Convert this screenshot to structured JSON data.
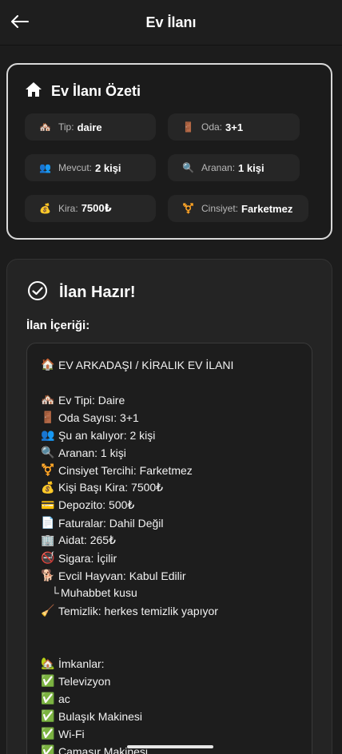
{
  "appbar": {
    "title": "Ev İlanı"
  },
  "summary": {
    "title": "Ev İlanı Özeti",
    "chips": [
      {
        "emoji": "🏘️",
        "label": "Tip:",
        "value": "daire"
      },
      {
        "emoji": "🚪",
        "label": "Oda:",
        "value": "3+1"
      },
      {
        "emoji": "👥",
        "label": "Mevcut:",
        "value": "2 kişi"
      },
      {
        "emoji": "🔍",
        "label": "Aranan:",
        "value": "1 kişi"
      },
      {
        "emoji": "💰",
        "label": "Kira:",
        "value": "7500₺"
      },
      {
        "emoji": "⚧️",
        "label": "Cinsiyet:",
        "value": "Farketmez"
      }
    ]
  },
  "result": {
    "title": "İlan Hazır!",
    "content_label": "İlan İçeriği:",
    "lines": [
      {
        "emoji": "🏠",
        "text": "EV ARKADAŞI / KİRALIK EV İLANI"
      },
      {
        "emoji": "🏘️",
        "text": "Ev Tipi: Daire"
      },
      {
        "emoji": "🚪",
        "text": "Oda Sayısı: 3+1"
      },
      {
        "emoji": "👥",
        "text": "Şu an kalıyor: 2 kişi"
      },
      {
        "emoji": "🔍",
        "text": "Aranan: 1 kişi"
      },
      {
        "emoji": "⚧️",
        "text": "Cinsiyet Tercihi: Farketmez"
      },
      {
        "emoji": "💰",
        "text": "Kişi Başı Kira: 7500₺"
      },
      {
        "emoji": "💳",
        "text": "Depozito: 500₺"
      },
      {
        "emoji": "📄",
        "text": "Faturalar: Dahil Değil"
      },
      {
        "emoji": "🏢",
        "text": "Aidat: 265₺"
      },
      {
        "emoji": "🚭",
        "text": "Sigara: İçilir"
      },
      {
        "emoji": "🐕",
        "text": "Evcil Hayvan: Kabul Edilir"
      },
      {
        "emoji": "└",
        "text": "Muhabbet kusu"
      },
      {
        "emoji": "🧹",
        "text": "Temizlik: herkes temizlik yapıyor"
      },
      {
        "emoji": "🏡",
        "text": "İmkanlar:"
      },
      {
        "emoji": "✅",
        "text": "Televizyon"
      },
      {
        "emoji": "✅",
        "text": "ac"
      },
      {
        "emoji": "✅",
        "text": "Bulaşık Makinesi"
      },
      {
        "emoji": "✅",
        "text": "Wi-Fi"
      },
      {
        "emoji": "✅",
        "text": "Çamaşır Makinesi"
      }
    ]
  }
}
